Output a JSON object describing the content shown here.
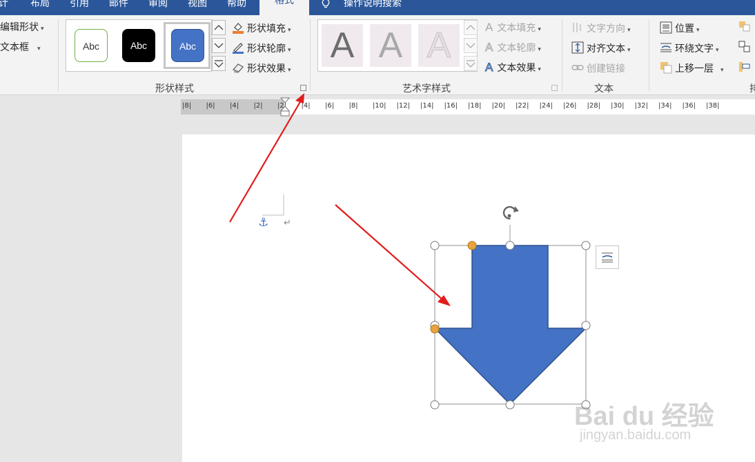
{
  "tabs": {
    "t1": "计",
    "t2": "布局",
    "t3": "引用",
    "t4": "邮件",
    "t5": "审阅",
    "t6": "视图",
    "t7": "帮助",
    "active": "格式",
    "tellme": "操作说明搜索"
  },
  "insert_shapes": {
    "edit_shape": "编辑形状",
    "text_box": "文本框"
  },
  "shape_styles": {
    "styles": [
      "Abc",
      "Abc",
      "Abc"
    ],
    "fill": "形状填充",
    "outline": "形状轮廓",
    "effects": "形状效果",
    "label": "形状样式"
  },
  "wordart": {
    "letters": [
      "A",
      "A",
      "A"
    ],
    "text_fill": "文本填充",
    "text_outline": "文本轮廓",
    "text_effects": "文本效果",
    "label": "艺术字样式"
  },
  "text_group": {
    "direction": "文字方向",
    "align": "对齐文本",
    "link": "创建链接",
    "label": "文本"
  },
  "arrange": {
    "position": "位置",
    "wrap": "环绕文字",
    "bring_forward": "上移一层",
    "label": "排"
  },
  "ruler": {
    "numbers": [
      "8",
      "6",
      "4",
      "2",
      "2",
      "4",
      "6",
      "8",
      "10",
      "12",
      "14",
      "16",
      "18",
      "20",
      "22",
      "24",
      "26",
      "28",
      "30",
      "32",
      "34",
      "36",
      "38"
    ]
  },
  "document": {
    "paragraph_mark": "↵",
    "anchor": "⚓"
  },
  "watermark": {
    "logo": "Bai du 经验",
    "url": "jingyan.baidu.com"
  },
  "colors": {
    "title_bar": "#2b579a",
    "shape_fill": "#4472c4",
    "shape_stroke": "#2f528f",
    "annotation_arrow": "#e31b1b",
    "handle": "#e8a33c",
    "fill_icon_orange": "#ed7d31",
    "outline_icon_blue": "#4472c4"
  }
}
